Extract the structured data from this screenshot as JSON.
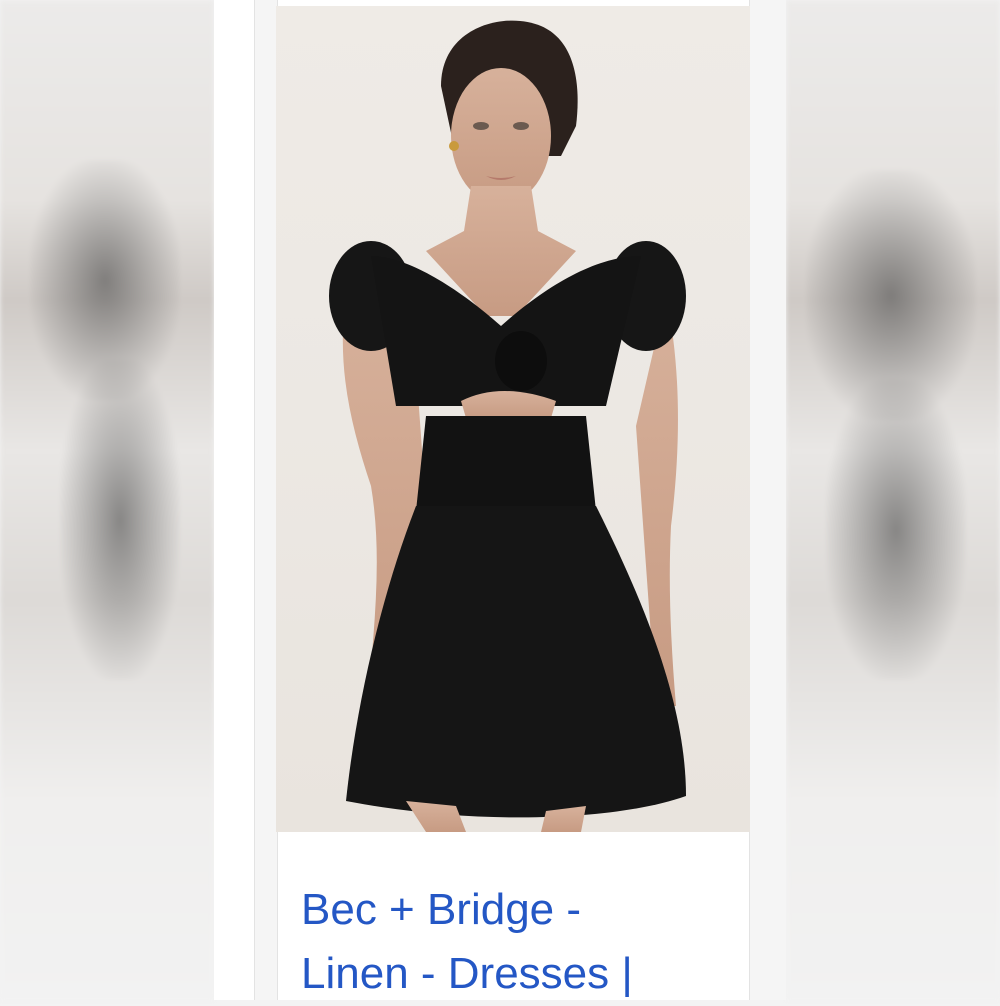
{
  "listing": {
    "title_line1": "Bec + Bridge -",
    "title_line2": "Linen - Dresses |"
  },
  "photo": {
    "subject": "model-in-black-linen-mini-dress-icon"
  },
  "colors": {
    "title_link": "#2457c5",
    "dress": "#141414",
    "background": "#ece8e3"
  }
}
